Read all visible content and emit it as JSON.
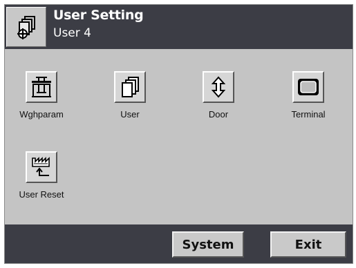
{
  "header": {
    "title": "User Setting",
    "subtitle": "User 4",
    "icon": "user-settings-icon"
  },
  "tiles": [
    {
      "label": "Wghparam",
      "icon": "weighing-param-icon"
    },
    {
      "label": "User",
      "icon": "user-pages-icon"
    },
    {
      "label": "Door",
      "icon": "door-updown-icon"
    },
    {
      "label": "Terminal",
      "icon": "terminal-icon"
    },
    {
      "label": "User Reset",
      "icon": "factory-reset-icon"
    }
  ],
  "footer": {
    "system_label": "System",
    "exit_label": "Exit"
  },
  "colors": {
    "header_bg": "#3c3d45",
    "panel_bg": "#c4c4c4",
    "button_face": "#d6d6d6"
  }
}
